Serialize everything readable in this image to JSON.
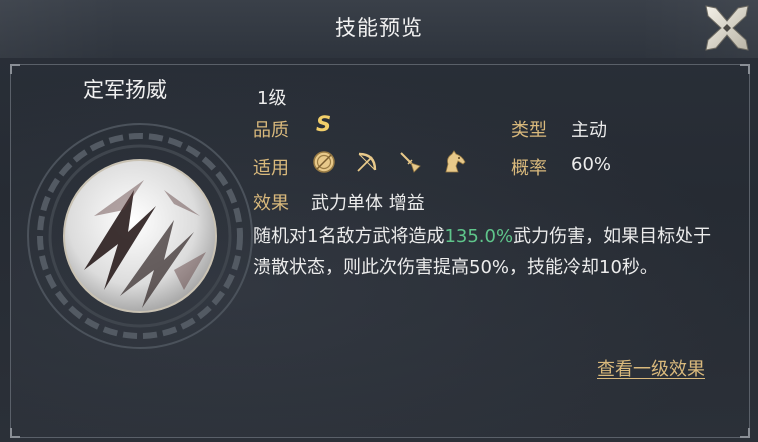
{
  "header": {
    "title": "技能预览"
  },
  "skill": {
    "name": "定军扬威",
    "level": "1级",
    "quality_label": "品质",
    "quality_value": "S",
    "type_label": "类型",
    "type_value": "主动",
    "applicable_label": "适用",
    "applicable_icons": [
      "shield-icon",
      "bow-icon",
      "spear-icon",
      "horse-icon"
    ],
    "chance_label": "概率",
    "chance_value": "60%",
    "effect_label": "效果",
    "effect_value": "武力单体 增益",
    "description_pre": "随机对1名敌方武将造成",
    "description_highlight": "135.0%",
    "description_post": "武力伤害，如果目标处于溃散状态，则此次伤害提高50%，技能冷却10秒。"
  },
  "footer": {
    "view_link": "查看一级效果"
  },
  "colors": {
    "label_gold": "#d9b97c",
    "grade_gold": "#f2cf6a",
    "highlight_green": "#5fc58b",
    "background": "#2a3039"
  }
}
